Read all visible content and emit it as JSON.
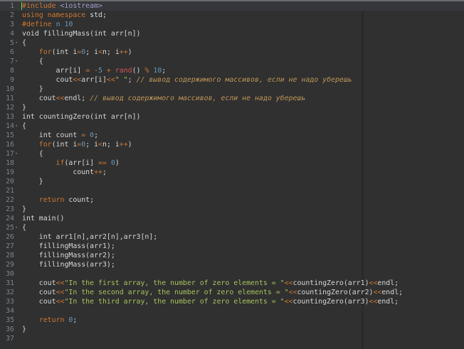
{
  "editor": {
    "active_line": 1,
    "colors": {
      "background": "#303030",
      "gutter": "#2e3032",
      "keyword": "#cc7832",
      "number": "#6897bb",
      "string": "#a5c25c",
      "comment": "#bc9458",
      "function": "#d25252"
    },
    "lines": [
      {
        "n": "1",
        "fold": "",
        "tokens": [
          [
            "pp",
            "#include "
          ],
          [
            "inc",
            "<iostream>"
          ]
        ]
      },
      {
        "n": "2",
        "fold": "",
        "tokens": [
          [
            "kw",
            "using namespace "
          ],
          [
            "tx",
            "std;"
          ]
        ]
      },
      {
        "n": "3",
        "fold": "",
        "tokens": [
          [
            "pp",
            "#define "
          ],
          [
            "num",
            "n 10"
          ]
        ]
      },
      {
        "n": "4",
        "fold": "",
        "tokens": [
          [
            "tx",
            "void fillingMass(int arr[n])"
          ]
        ]
      },
      {
        "n": "5",
        "fold": "▾",
        "tokens": [
          [
            "tx",
            "{"
          ]
        ]
      },
      {
        "n": "6",
        "fold": "",
        "tokens": [
          [
            "kw",
            "    for"
          ],
          [
            "tx",
            "(int i"
          ],
          [
            "op",
            "="
          ],
          [
            "num",
            "0"
          ],
          [
            "tx",
            "; i"
          ],
          [
            "op",
            "<"
          ],
          [
            "tx",
            "n; i"
          ],
          [
            "op",
            "++"
          ],
          [
            "tx",
            ")"
          ]
        ]
      },
      {
        "n": "7",
        "fold": "▾",
        "tokens": [
          [
            "tx",
            "    {"
          ]
        ]
      },
      {
        "n": "8",
        "fold": "",
        "tokens": [
          [
            "tx",
            "        arr[i] "
          ],
          [
            "op",
            "= -"
          ],
          [
            "num",
            "5"
          ],
          [
            "op",
            " + "
          ],
          [
            "fn",
            "rand"
          ],
          [
            "tx",
            "() "
          ],
          [
            "op",
            "% "
          ],
          [
            "num",
            "10"
          ],
          [
            "tx",
            ";"
          ]
        ]
      },
      {
        "n": "9",
        "fold": "",
        "tokens": [
          [
            "tx",
            "        cout"
          ],
          [
            "op",
            "<<"
          ],
          [
            "tx",
            "arr[i]"
          ],
          [
            "op",
            "<<"
          ],
          [
            "str",
            "\" \""
          ],
          [
            "tx",
            "; "
          ],
          [
            "cm",
            "// вывод содержимого массивов, если не надо уберешь"
          ]
        ]
      },
      {
        "n": "10",
        "fold": "",
        "tokens": [
          [
            "tx",
            "    }"
          ]
        ]
      },
      {
        "n": "11",
        "fold": "",
        "tokens": [
          [
            "tx",
            "    cout"
          ],
          [
            "op",
            "<<"
          ],
          [
            "tx",
            "endl; "
          ],
          [
            "cm",
            "// вывод содержимого массивов, если не надо уберешь"
          ]
        ]
      },
      {
        "n": "12",
        "fold": "",
        "tokens": [
          [
            "tx",
            "}"
          ]
        ]
      },
      {
        "n": "13",
        "fold": "",
        "tokens": [
          [
            "tx",
            "int countingZero(int arr[n])"
          ]
        ]
      },
      {
        "n": "14",
        "fold": "▾",
        "tokens": [
          [
            "tx",
            "{"
          ]
        ]
      },
      {
        "n": "15",
        "fold": "",
        "tokens": [
          [
            "tx",
            "    int count "
          ],
          [
            "op",
            "= "
          ],
          [
            "num",
            "0"
          ],
          [
            "tx",
            ";"
          ]
        ]
      },
      {
        "n": "16",
        "fold": "",
        "tokens": [
          [
            "kw",
            "    for"
          ],
          [
            "tx",
            "(int i"
          ],
          [
            "op",
            "="
          ],
          [
            "num",
            "0"
          ],
          [
            "tx",
            "; i"
          ],
          [
            "op",
            "<"
          ],
          [
            "tx",
            "n; i"
          ],
          [
            "op",
            "++"
          ],
          [
            "tx",
            ")"
          ]
        ]
      },
      {
        "n": "17",
        "fold": "▾",
        "tokens": [
          [
            "tx",
            "    {"
          ]
        ]
      },
      {
        "n": "18",
        "fold": "",
        "tokens": [
          [
            "kw",
            "        if"
          ],
          [
            "tx",
            "(arr[i] "
          ],
          [
            "op",
            "== "
          ],
          [
            "num",
            "0"
          ],
          [
            "tx",
            ")"
          ]
        ]
      },
      {
        "n": "19",
        "fold": "",
        "tokens": [
          [
            "tx",
            "            count"
          ],
          [
            "op",
            "++"
          ],
          [
            "tx",
            ";"
          ]
        ]
      },
      {
        "n": "20",
        "fold": "",
        "tokens": [
          [
            "tx",
            "    }"
          ]
        ]
      },
      {
        "n": "21",
        "fold": "",
        "tokens": []
      },
      {
        "n": "22",
        "fold": "",
        "tokens": [
          [
            "kw",
            "    return "
          ],
          [
            "tx",
            "count;"
          ]
        ]
      },
      {
        "n": "23",
        "fold": "",
        "tokens": [
          [
            "tx",
            "}"
          ]
        ]
      },
      {
        "n": "24",
        "fold": "",
        "tokens": [
          [
            "tx",
            "int main()"
          ]
        ]
      },
      {
        "n": "25",
        "fold": "▾",
        "tokens": [
          [
            "tx",
            "{"
          ]
        ]
      },
      {
        "n": "26",
        "fold": "",
        "tokens": [
          [
            "tx",
            "    int arr1[n],arr2[n],arr3[n];"
          ]
        ]
      },
      {
        "n": "27",
        "fold": "",
        "tokens": [
          [
            "tx",
            "    fillingMass(arr1);"
          ]
        ]
      },
      {
        "n": "28",
        "fold": "",
        "tokens": [
          [
            "tx",
            "    fillingMass(arr2);"
          ]
        ]
      },
      {
        "n": "29",
        "fold": "",
        "tokens": [
          [
            "tx",
            "    fillingMass(arr3);"
          ]
        ]
      },
      {
        "n": "30",
        "fold": "",
        "tokens": []
      },
      {
        "n": "31",
        "fold": "",
        "tokens": [
          [
            "tx",
            "    cout"
          ],
          [
            "op",
            "<<"
          ],
          [
            "str",
            "\"In the first array, the number of zero elements = \""
          ],
          [
            "op",
            "<<"
          ],
          [
            "tx",
            "countingZero(arr1)"
          ],
          [
            "op",
            "<<"
          ],
          [
            "tx",
            "endl;"
          ]
        ]
      },
      {
        "n": "32",
        "fold": "",
        "tokens": [
          [
            "tx",
            "    cout"
          ],
          [
            "op",
            "<<"
          ],
          [
            "str",
            "\"In the second array, the number of zero elements = \""
          ],
          [
            "op",
            "<<"
          ],
          [
            "tx",
            "countingZero(arr2)"
          ],
          [
            "op",
            "<<"
          ],
          [
            "tx",
            "endl;"
          ]
        ]
      },
      {
        "n": "33",
        "fold": "",
        "tokens": [
          [
            "tx",
            "    cout"
          ],
          [
            "op",
            "<<"
          ],
          [
            "str",
            "\"In the third array, the number of zero elements = \""
          ],
          [
            "op",
            "<<"
          ],
          [
            "tx",
            "countingZero(arr3)"
          ],
          [
            "op",
            "<<"
          ],
          [
            "tx",
            "endl;"
          ]
        ]
      },
      {
        "n": "34",
        "fold": "",
        "tokens": []
      },
      {
        "n": "35",
        "fold": "",
        "tokens": [
          [
            "kw",
            "    return "
          ],
          [
            "num",
            "0"
          ],
          [
            "tx",
            ";"
          ]
        ]
      },
      {
        "n": "36",
        "fold": "",
        "tokens": [
          [
            "tx",
            "}"
          ]
        ]
      },
      {
        "n": "37",
        "fold": "",
        "tokens": []
      }
    ]
  }
}
